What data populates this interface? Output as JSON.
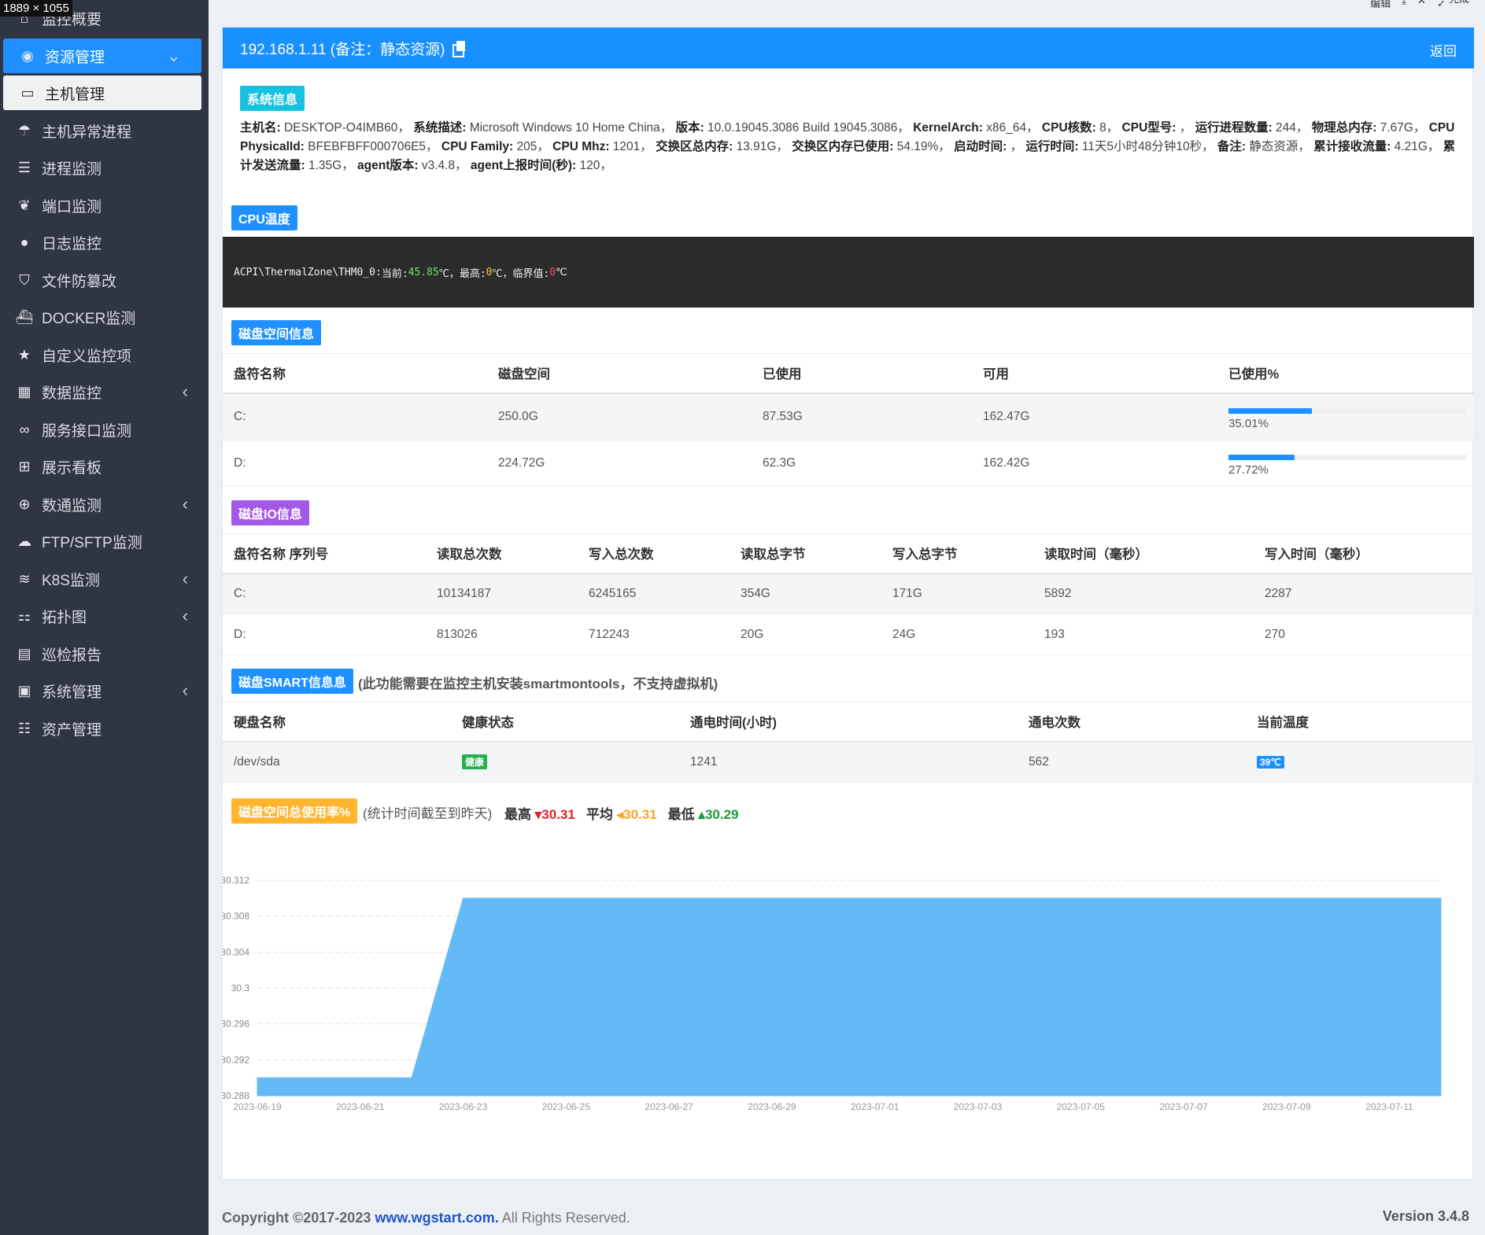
{
  "overlay": {
    "dims": "1889 × 1055"
  },
  "toolbar": {
    "edit": "编辑",
    "done": "完成"
  },
  "sidebar": {
    "items": [
      {
        "label": "监控概要",
        "icon": "home-icon"
      },
      {
        "label": "资源管理",
        "icon": "dashboard-icon"
      },
      {
        "label": "主机管理",
        "icon": "monitor-icon"
      },
      {
        "label": "主机异常进程",
        "icon": "umbrella-icon"
      },
      {
        "label": "进程监测",
        "icon": "list-icon"
      },
      {
        "label": "端口监测",
        "icon": "leaf-icon"
      },
      {
        "label": "日志监控",
        "icon": "comment-icon"
      },
      {
        "label": "文件防篡改",
        "icon": "shield-icon"
      },
      {
        "label": "DOCKER监测",
        "icon": "docker-icon"
      },
      {
        "label": "自定义监控项",
        "icon": "star-icon"
      },
      {
        "label": "数据监控",
        "icon": "table-icon"
      },
      {
        "label": "服务接口监测",
        "icon": "link-icon"
      },
      {
        "label": "展示看板",
        "icon": "grid-icon"
      },
      {
        "label": "数通监测",
        "icon": "globe-icon"
      },
      {
        "label": "FTP/SFTP监测",
        "icon": "cloud-upload-icon"
      },
      {
        "label": "K8S监测",
        "icon": "layers-icon"
      },
      {
        "label": "拓扑图",
        "icon": "sitemap-icon"
      },
      {
        "label": "巡检报告",
        "icon": "calendar-icon"
      },
      {
        "label": "系统管理",
        "icon": "terminal-icon"
      },
      {
        "label": "资产管理",
        "icon": "server-icon"
      }
    ]
  },
  "header": {
    "title": "192.168.1.11 (备注：静态资源)",
    "back": "返回"
  },
  "sysinfo": {
    "tag": "系统信息",
    "hostname_label": "主机名:",
    "hostname": " DESKTOP-O4IMB60，",
    "desc_label": "系统描述:",
    "desc": " Microsoft Windows 10 Home China，",
    "ver_label": "版本:",
    "ver": " 10.0.19045.3086 Build 19045.3086，",
    "arch_label": "KernelArch:",
    "arch": " x86_64，",
    "cores_label": "CPU核数:",
    "cores": " 8，",
    "cpumodel_label": "CPU型号:",
    "cpumodel": " ，",
    "procs_label": "运行进程数量:",
    "procs": " 244，",
    "mem_label": "物理总内存:",
    "mem": " 7.67G，",
    "physid_label": "CPU PhysicalId:",
    "physid": " BFEBFBFF000706E5，",
    "family_label": "CPU Family:",
    "family": " 205，",
    "mhz_label": "CPU Mhz:",
    "mhz": " 1201，",
    "swap_label": "交换区总内存:",
    "swap": " 13.91G，",
    "swapused_label": "交换区内存已使用:",
    "swapused": " 54.19%，",
    "boot_label": "启动时间:",
    "boot": " ，",
    "uptime_label": "运行时间:",
    "uptime": " 11天5小时48分钟10秒，",
    "note_label": "备注:",
    "note": " 静态资源，",
    "rx_label": "累计接收流量:",
    "rx": " 4.21G，",
    "tx_label": "累计发送流量:",
    "tx": " 1.35G，",
    "agentver_label": "agent版本:",
    "agentver": " v3.4.8，",
    "interval_label": "agent上报时间(秒):",
    "interval": " 120，"
  },
  "cpu_temp": {
    "tag": "CPU温度",
    "zone": "ACPI\\ThermalZone\\THM0_0:",
    "current_label": " 当前:",
    "current": "45.85",
    "max_label": "℃，最高:",
    "max": "0",
    "crit_label": "℃，临界值:",
    "crit": "0",
    "unit": "℃"
  },
  "disk_space": {
    "tag": "磁盘空间信息",
    "headers": [
      "盘符名称",
      "磁盘空间",
      "已使用",
      "可用",
      "已使用%"
    ],
    "rows": [
      {
        "name": "C:",
        "total": "250.0G",
        "used": "87.53G",
        "free": "162.47G",
        "pct_label": "35.01%",
        "pct": 35.01
      },
      {
        "name": "D:",
        "total": "224.72G",
        "used": "62.3G",
        "free": "162.42G",
        "pct_label": "27.72%",
        "pct": 27.72
      }
    ]
  },
  "disk_io": {
    "tag": "磁盘IO信息",
    "headers": [
      "盘符名称 序列号",
      "读取总次数",
      "写入总次数",
      "读取总字节",
      "写入总字节",
      "读取时间（毫秒）",
      "写入时间（毫秒）"
    ],
    "rows": [
      [
        "C:",
        "10134187",
        "6245165",
        "354G",
        "171G",
        "5892",
        "2287"
      ],
      [
        "D:",
        "813026",
        "712243",
        "20G",
        "24G",
        "193",
        "270"
      ]
    ]
  },
  "smart": {
    "tag": "磁盘SMART信息息",
    "note": "(此功能需要在监控主机安装smartmontools，不支持虚拟机)",
    "headers": [
      "硬盘名称",
      "健康状态",
      "通电时间(小时)",
      "通电次数",
      "当前温度"
    ],
    "rows": [
      {
        "name": "/dev/sda",
        "health": "健康",
        "hours": "1241",
        "count": "562",
        "temp": "39℃"
      }
    ]
  },
  "usage": {
    "tag": "磁盘空间总使用率%",
    "note": "(统计时间截至到昨天)",
    "max_label": "最高",
    "max": "30.31",
    "avg_label": "平均",
    "avg": "30.31",
    "min_label": "最低",
    "min": "30.29"
  },
  "chart_data": {
    "type": "area",
    "x": [
      "2023-06-19",
      "2023-06-20",
      "2023-06-21",
      "2023-06-22",
      "2023-06-23",
      "2023-06-24",
      "2023-06-25",
      "2023-06-26",
      "2023-06-27",
      "2023-06-28",
      "2023-06-29",
      "2023-06-30",
      "2023-07-01",
      "2023-07-02",
      "2023-07-03",
      "2023-07-04",
      "2023-07-05",
      "2023-07-06",
      "2023-07-07",
      "2023-07-08",
      "2023-07-09",
      "2023-07-10",
      "2023-07-11",
      "2023-07-12"
    ],
    "x_tick_labels": [
      "2023-06-19",
      "2023-06-21",
      "2023-06-23",
      "2023-06-25",
      "2023-06-27",
      "2023-06-29",
      "2023-07-01",
      "2023-07-03",
      "2023-07-05",
      "2023-07-07",
      "2023-07-09",
      "2023-07-11"
    ],
    "y": [
      30.29,
      30.29,
      30.29,
      30.29,
      30.31,
      30.31,
      30.31,
      30.31,
      30.31,
      30.31,
      30.31,
      30.31,
      30.31,
      30.31,
      30.31,
      30.31,
      30.31,
      30.31,
      30.31,
      30.31,
      30.31,
      30.31,
      30.31,
      30.31
    ],
    "y_ticks": [
      "30.312",
      "30.308",
      "30.304",
      "30.3",
      "30.296",
      "30.292",
      "30.288"
    ],
    "ylim": [
      30.288,
      30.312
    ],
    "color": "#64b9f7",
    "grid": true
  },
  "footer": {
    "copyright": "Copyright ©2017-2023 ",
    "site": "www.wgstart.com.",
    "rights": " All Rights Reserved.",
    "version": "Version 3.4.8"
  }
}
